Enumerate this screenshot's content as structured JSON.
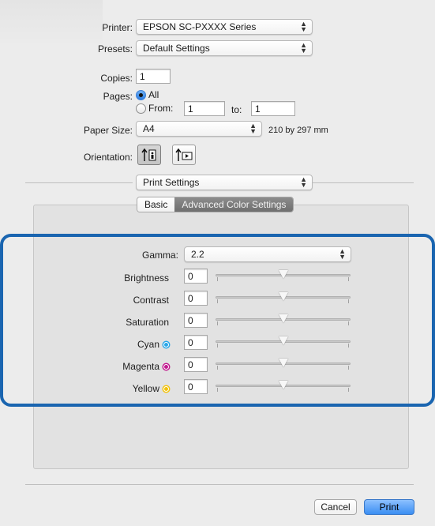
{
  "printer": {
    "label": "Printer:",
    "value": "EPSON SC-PXXXX Series"
  },
  "presets": {
    "label": "Presets:",
    "value": "Default Settings"
  },
  "copies": {
    "label": "Copies:",
    "value": "1"
  },
  "pages": {
    "label": "Pages:",
    "all_label": "All",
    "from_label": "From:",
    "from_value": "1",
    "to_label": "to:",
    "to_value": "1"
  },
  "paper_size": {
    "label": "Paper Size:",
    "value": "A4",
    "dimensions": "210 by 297 mm"
  },
  "orientation": {
    "label": "Orientation:"
  },
  "section_popup": {
    "value": "Print Settings"
  },
  "tabs": [
    {
      "label": "Basic"
    },
    {
      "label": "Advanced Color Settings"
    }
  ],
  "gamma": {
    "label": "Gamma:",
    "value": "2.2"
  },
  "sliders": [
    {
      "label": "Brightness",
      "value": "0",
      "level": 0.5,
      "dot_color": null
    },
    {
      "label": "Contrast",
      "value": "0",
      "level": 0.5,
      "dot_color": null
    },
    {
      "label": "Saturation",
      "value": "0",
      "level": 0.5,
      "dot_color": null
    },
    {
      "label": "Cyan",
      "value": "0",
      "level": 0.5,
      "dot_color": "#2aa7e8"
    },
    {
      "label": "Magenta",
      "value": "0",
      "level": 0.5,
      "dot_color": "#c2198f"
    },
    {
      "label": "Yellow",
      "value": "0",
      "level": 0.5,
      "dot_color": "#f2c20c"
    }
  ],
  "buttons": {
    "cancel": "Cancel",
    "print": "Print"
  },
  "colors": {
    "highlight": "#1a65b0",
    "accent": "#3b8ef2"
  }
}
